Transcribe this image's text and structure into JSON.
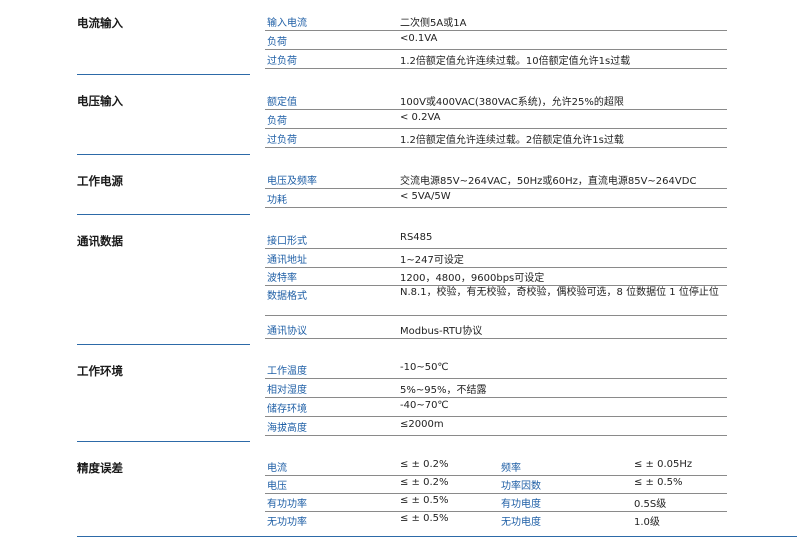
{
  "sections": {
    "current_input": {
      "title": "电流输入",
      "rows": [
        {
          "k": "输入电流",
          "v": "二次侧5A或1A"
        },
        {
          "k": "负荷",
          "v": "<0.1VA"
        },
        {
          "k": "过负荷",
          "v": "1.2倍额定值允许连续过载。10倍额定值允许1s过载"
        }
      ]
    },
    "voltage_input": {
      "title": "电压输入",
      "rows": [
        {
          "k": "额定值",
          "v": "100V或400VAC(380VAC系统)，允许25%的超限"
        },
        {
          "k": "负荷",
          "v": "< 0.2VA"
        },
        {
          "k": "过负荷",
          "v": "1.2倍额定值允许连续过载。2倍额定值允许1s过载"
        }
      ]
    },
    "power_supply": {
      "title": "工作电源",
      "rows": [
        {
          "k": "电压及频率",
          "v": "交流电源85V~264VAC，50Hz或60Hz，直流电源85V~264VDC"
        },
        {
          "k": "功耗",
          "v": "< 5VA/5W"
        }
      ]
    },
    "communication": {
      "title": "通讯数据",
      "rows": [
        {
          "k": "接口形式",
          "v": "RS485"
        },
        {
          "k": "通讯地址",
          "v": "1~247可设定"
        },
        {
          "k": "波特率",
          "v": "1200，4800，9600bps可设定"
        },
        {
          "k": "数据格式",
          "v": "N.8.1，校验，有无校验，奇校验，偶校验可选，8 位数据位 1 位停止位"
        },
        {
          "k": "通讯协议",
          "v": "Modbus-RTU协议"
        }
      ]
    },
    "environment": {
      "title": "工作环境",
      "rows": [
        {
          "k": "工作温度",
          "v": "-10~50℃"
        },
        {
          "k": "相对湿度",
          "v": "5%~95%，不结露"
        },
        {
          "k": "储存环境",
          "v": "-40~70℃"
        },
        {
          "k": "海拔高度",
          "v": "≤2000m"
        }
      ]
    },
    "accuracy": {
      "title": "精度误差",
      "left": [
        {
          "k": "电流",
          "v": "≤ ± 0.2%"
        },
        {
          "k": "电压",
          "v": "≤ ± 0.2%"
        },
        {
          "k": "有功功率",
          "v": "≤ ± 0.5%"
        },
        {
          "k": "无功功率",
          "v": "≤ ± 0.5%"
        }
      ],
      "right": [
        {
          "k": "频率",
          "v": "≤ ± 0.05Hz"
        },
        {
          "k": "功率因数",
          "v": "≤ ± 0.5%"
        },
        {
          "k": "有功电度",
          "v": "0.5S级"
        },
        {
          "k": "无功电度",
          "v": "1.0级"
        }
      ]
    }
  }
}
